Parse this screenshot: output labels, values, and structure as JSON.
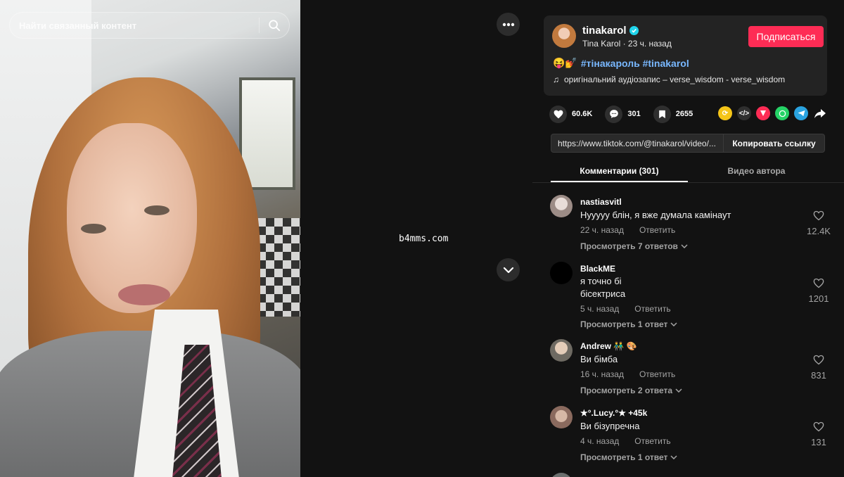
{
  "search": {
    "placeholder": "Найти связанный контент"
  },
  "watermark": "b4mms.com",
  "author": {
    "username": "tinakarol",
    "display_name": "Tina Karol",
    "time_ago": "23 ч. назад",
    "subtitle": "Tina Karol · 23 ч. назад",
    "follow_label": "Подписаться",
    "caption_emojis": "😝💅",
    "hashtags": "#тінакароль #tinakarol",
    "music": "оригінальний аудіозапис – verse_wisdom - verse_wisdom"
  },
  "stats": {
    "likes": "60.6K",
    "comments": "301",
    "saves": "2655"
  },
  "share": {
    "colors": [
      "#f5c518",
      "#2f2f2f",
      "#fe2c55",
      "#25d366",
      "#2aa3e0"
    ]
  },
  "link": {
    "url": "https://www.tiktok.com/@tinakarol/video/...",
    "copy_label": "Копировать ссылку"
  },
  "tabs": {
    "comments": "Комментарии (301)",
    "author_videos": "Видео автора"
  },
  "comments": [
    {
      "user": "nastiasvitl",
      "text": "Нууууу блін, я вже думала камінаут",
      "time": "22 ч. назад",
      "reply": "Ответить",
      "view": "Просмотреть 7 ответов",
      "likes": "12.4K",
      "avatar_color": "#9c8c86"
    },
    {
      "user": "BlackME",
      "text1": "я точно бі",
      "text2": "бісектриса",
      "time": "5 ч. назад",
      "reply": "Ответить",
      "view": "Просмотреть 1 ответ",
      "likes": "1201",
      "avatar_color": "#000000"
    },
    {
      "user": "Andrew 👬 🎨",
      "text": "Ви бімба",
      "time": "16 ч. назад",
      "reply": "Ответить",
      "view": "Просмотреть 2 ответа",
      "likes": "831",
      "avatar_color": "#b9b3a8"
    },
    {
      "user": "★°.Lucy.°★ +45k",
      "text": "Ви бізупречна",
      "time": "4 ч. назад",
      "reply": "Ответить",
      "view": "Просмотреть 1 ответ",
      "likes": "131",
      "avatar_color": "#8a6a5e"
    }
  ]
}
